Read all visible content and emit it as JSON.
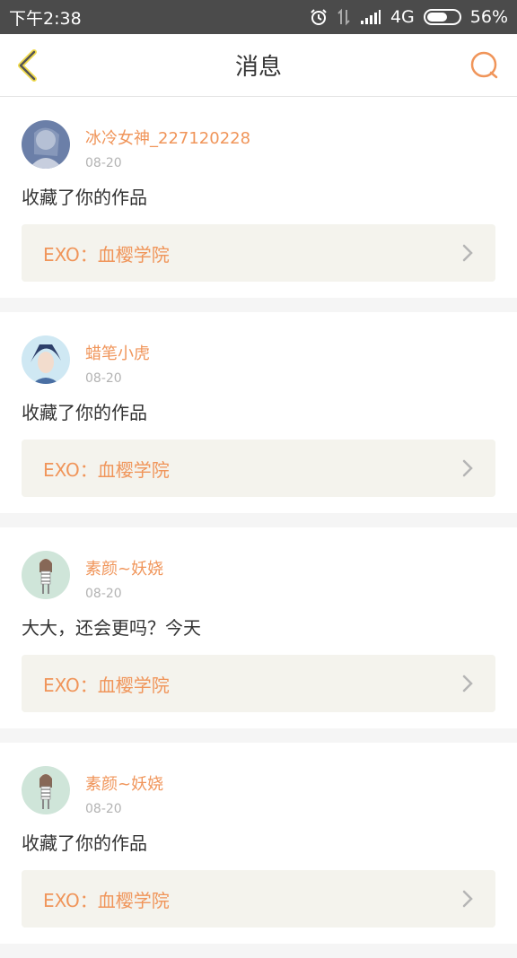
{
  "status_bar": {
    "time": "下午2:38",
    "network": "4G",
    "battery": "56%",
    "battery_level": 0.56
  },
  "header": {
    "title": "消息"
  },
  "messages": [
    {
      "user": "冰冷女神_227120228",
      "date": "08-20",
      "text": "收藏了你的作品",
      "work": "EXO：血樱学院"
    },
    {
      "user": "蜡笔小虎",
      "date": "08-20",
      "text": "收藏了你的作品",
      "work": "EXO：血樱学院"
    },
    {
      "user": "素颜~妖娆",
      "date": "08-20",
      "text": "大大，还会更吗？今天",
      "work": "EXO：血樱学院"
    },
    {
      "user": "素颜~妖娆",
      "date": "08-20",
      "text": "收藏了你的作品",
      "work": "EXO：血樱学院"
    }
  ],
  "colors": {
    "accent": "#f0955a",
    "link_bg": "#f4f3ed",
    "status_bar": "#4b4b4b"
  }
}
